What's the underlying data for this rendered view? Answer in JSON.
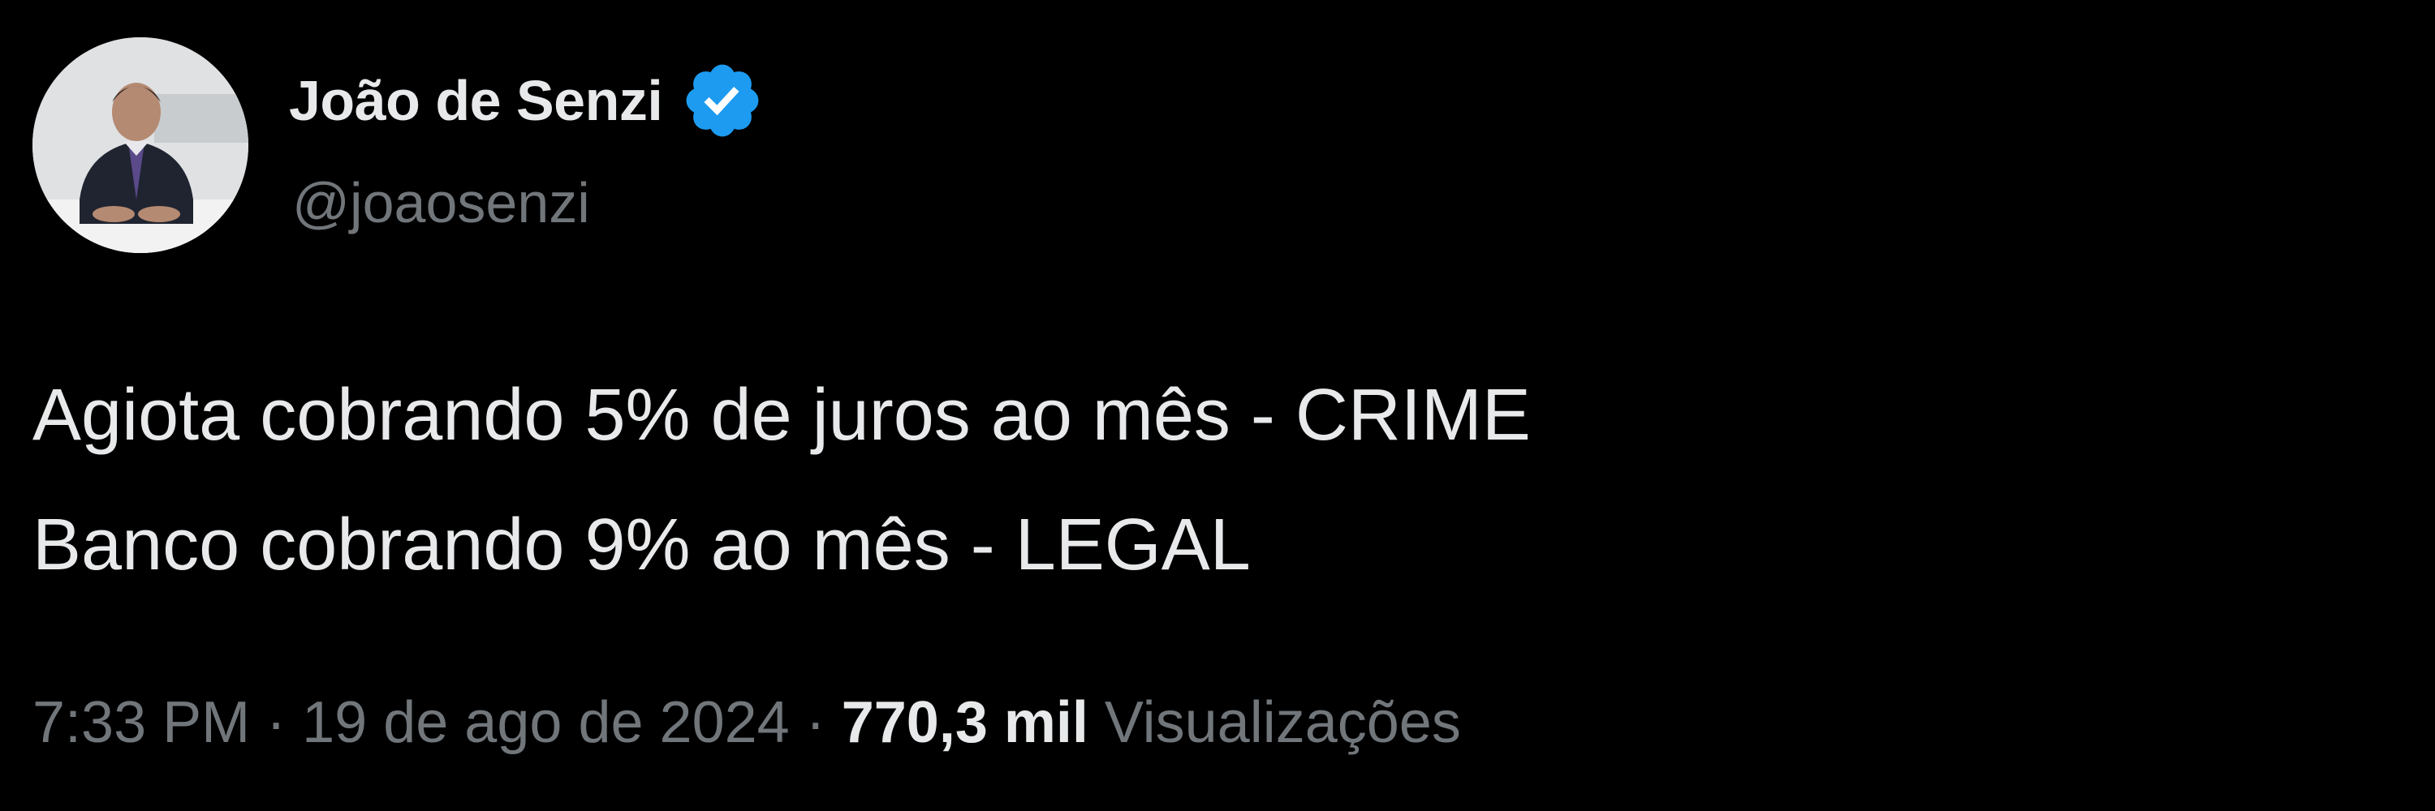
{
  "author": {
    "name": "João de Senzi",
    "handle": "@joaosenzi",
    "verified": true,
    "avatar_icon": "profile-photo"
  },
  "tweet": {
    "lines": [
      "Agiota cobrando 5% de juros ao mês - CRIME",
      "Banco cobrando 9% ao mês - LEGAL"
    ]
  },
  "meta": {
    "time": "7:33 PM",
    "separator": " · ",
    "date": "19 de ago de 2024",
    "views_count": "770,3 mil",
    "views_label": "Visualizações"
  },
  "colors": {
    "background": "#000000",
    "primary_text": "#e7e9ea",
    "secondary_text": "#71767b",
    "verified_badge": "#1d9bf0"
  }
}
